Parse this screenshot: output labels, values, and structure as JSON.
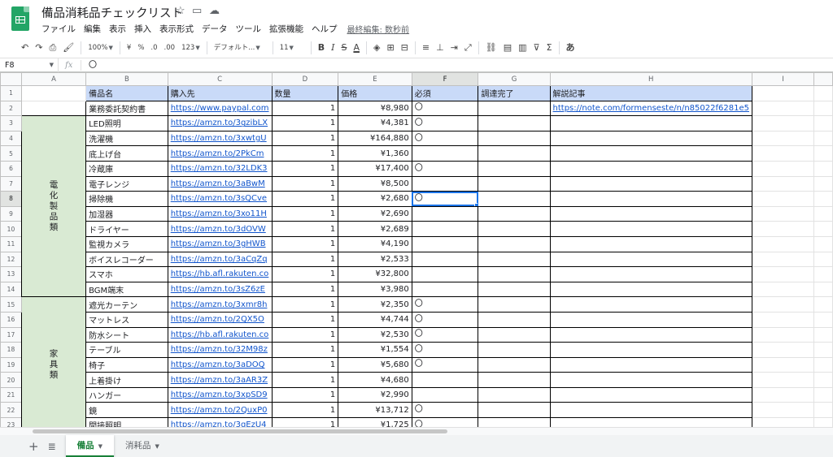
{
  "window": {
    "title": "備品消耗品チェックリスト",
    "title_icons": [
      "star-icon",
      "folder-move-icon",
      "cloud-status-icon"
    ]
  },
  "menu": {
    "items": [
      "ファイル",
      "編集",
      "表示",
      "挿入",
      "表示形式",
      "データ",
      "ツール",
      "拡張機能",
      "ヘルプ"
    ],
    "last_edit": "最終編集: 数秒前"
  },
  "toolbar": {
    "zoom": "100%",
    "currency": "¥",
    "percent": "%",
    "dec_decrease": ".0",
    "dec_increase": ".00",
    "more_formats": "123",
    "font": "デフォルト...",
    "font_size": "11",
    "bold": "B",
    "italic": "I",
    "strike": "S",
    "text_color": "A",
    "input_tools": "あ"
  },
  "formula_bar": {
    "cell_ref": "F8",
    "fx": "fx",
    "value": "〇"
  },
  "columns": [
    "A",
    "B",
    "C",
    "D",
    "E",
    "F",
    "G",
    "H",
    "I"
  ],
  "selected_column": "F",
  "selected_row": "8",
  "header_row": {
    "b": "備品名",
    "c": "購入先",
    "d": "数量",
    "e": "価格",
    "f": "必須",
    "g": "調達完了",
    "h": "解説記事"
  },
  "row2": {
    "name": "業務委託契約書",
    "url": "https://www.paypal.com",
    "qty": "1",
    "price": "¥8,980",
    "required": "〇",
    "article": "https://note.com/formenseste/n/n85022f6281e5"
  },
  "categories": {
    "electric": "電化製品類",
    "furniture": "家具類"
  },
  "items": [
    {
      "row": "3",
      "name": "LED照明",
      "url": "https://amzn.to/3gzibLX",
      "qty": "1",
      "price": "¥4,381",
      "required": "〇"
    },
    {
      "row": "4",
      "name": "洗濯機",
      "url": "https://amzn.to/3xwtgU",
      "qty": "1",
      "price": "¥164,880",
      "required": "〇"
    },
    {
      "row": "5",
      "name": "底上げ台",
      "url": "https://amzn.to/2PkCm",
      "qty": "1",
      "price": "¥1,360",
      "required": ""
    },
    {
      "row": "6",
      "name": "冷蔵庫",
      "url": "https://amzn.to/32LDK3",
      "qty": "1",
      "price": "¥17,400",
      "required": "〇"
    },
    {
      "row": "7",
      "name": "電子レンジ",
      "url": "https://amzn.to/3aBwM",
      "qty": "1",
      "price": "¥8,500",
      "required": ""
    },
    {
      "row": "8",
      "name": "掃除機",
      "url": "https://amzn.to/3sQCve",
      "qty": "1",
      "price": "¥2,680",
      "required": "〇"
    },
    {
      "row": "9",
      "name": "加湿器",
      "url": "https://amzn.to/3xo11H",
      "qty": "1",
      "price": "¥2,690",
      "required": ""
    },
    {
      "row": "10",
      "name": "ドライヤー",
      "url": "https://amzn.to/3dOVW",
      "qty": "1",
      "price": "¥2,689",
      "required": ""
    },
    {
      "row": "11",
      "name": "監視カメラ",
      "url": "https://amzn.to/3gHWB",
      "qty": "1",
      "price": "¥4,190",
      "required": ""
    },
    {
      "row": "12",
      "name": "ボイスレコーダー",
      "url": "https://amzn.to/3aCqZq",
      "qty": "1",
      "price": "¥2,533",
      "required": ""
    },
    {
      "row": "13",
      "name": "スマホ",
      "url": "https://hb.afl.rakuten.co",
      "qty": "1",
      "price": "¥32,800",
      "required": ""
    },
    {
      "row": "14",
      "name": "BGM端末",
      "url": "https://amzn.to/3sZ6zE",
      "qty": "1",
      "price": "¥3,980",
      "required": ""
    },
    {
      "row": "15",
      "name": "遮光カーテン",
      "url": "https://amzn.to/3xmr8h",
      "qty": "1",
      "price": "¥2,350",
      "required": "〇"
    },
    {
      "row": "16",
      "name": "マットレス",
      "url": "https://amzn.to/2QX5O",
      "qty": "1",
      "price": "¥4,744",
      "required": "〇"
    },
    {
      "row": "17",
      "name": "防水シート",
      "url": "https://hb.afl.rakuten.co",
      "qty": "1",
      "price": "¥2,530",
      "required": "〇"
    },
    {
      "row": "18",
      "name": "テーブル",
      "url": "https://amzn.to/32M98z",
      "qty": "1",
      "price": "¥1,554",
      "required": "〇"
    },
    {
      "row": "19",
      "name": "椅子",
      "url": "https://amzn.to/3aDOQ",
      "qty": "1",
      "price": "¥5,680",
      "required": "〇"
    },
    {
      "row": "20",
      "name": "上着掛け",
      "url": "https://amzn.to/3aAR3Z",
      "qty": "1",
      "price": "¥4,680",
      "required": ""
    },
    {
      "row": "21",
      "name": "ハンガー",
      "url": "https://amzn.to/3xpSD9",
      "qty": "1",
      "price": "¥2,990",
      "required": ""
    },
    {
      "row": "22",
      "name": "鏡",
      "url": "https://amzn.to/2QuxP0",
      "qty": "1",
      "price": "¥13,712",
      "required": "〇"
    },
    {
      "row": "23",
      "name": "間接照明",
      "url": "https://amzn.to/3gEzU4",
      "qty": "1",
      "price": "¥1,725",
      "required": "〇"
    }
  ],
  "sheet_tabs": [
    {
      "label": "備品",
      "active": true
    },
    {
      "label": "消耗品",
      "active": false
    }
  ],
  "colors": {
    "header_fill": "#c9daf8",
    "category_fill": "#d9ead3",
    "link": "#1155cc",
    "selection": "#1a73e8",
    "active_tab": "#188038"
  }
}
